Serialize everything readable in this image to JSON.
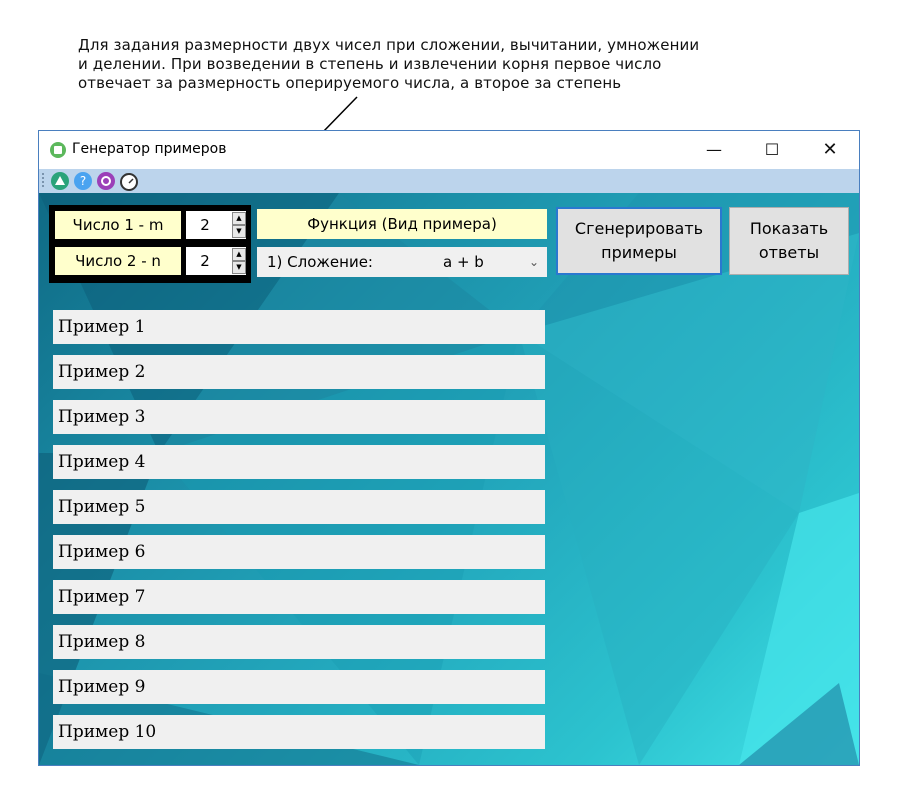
{
  "annotation": {
    "lines": [
      "Для задания размерности двух чисел при сложении, вычитании, умножении",
      "и делении. При возведении в степень и извлечении корня первое число",
      "отвечает за размерность оперируемого числа, а второе за степень"
    ]
  },
  "window": {
    "title": "Генератор примеров",
    "controls": {
      "minimize": "—",
      "maximize": "☐",
      "close": "✕"
    }
  },
  "toolbar": {
    "icons": [
      "up-triangle-icon",
      "help-icon",
      "settings-icon",
      "timer-icon"
    ],
    "help_glyph": "?"
  },
  "inputs": {
    "number1": {
      "label": "Число 1 - m",
      "value": "2"
    },
    "number2": {
      "label": "Число 2 - n",
      "value": "2"
    }
  },
  "function": {
    "label": "Функция (Вид примера)",
    "selected_name": "1) Сложение:",
    "selected_formula": "a + b"
  },
  "buttons": {
    "generate": "Сгенерировать примеры",
    "show_answers": "Показать ответы"
  },
  "examples": [
    "Пример 1",
    "Пример 2",
    "Пример 3",
    "Пример 4",
    "Пример 5",
    "Пример 6",
    "Пример 7",
    "Пример 8",
    "Пример 9",
    "Пример 10"
  ],
  "colors": {
    "label_bg": "#ffffcc",
    "window_border": "#4a7fbf",
    "toolbar_bg": "#bcd4ec",
    "accent_button_border": "#2a78d0"
  }
}
